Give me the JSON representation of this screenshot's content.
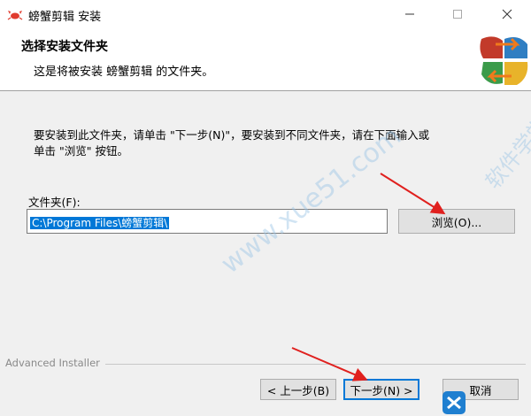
{
  "window": {
    "title": "螃蟹剪辑 安装",
    "minimize_icon": "minimize-icon",
    "maximize_icon": "maximize-icon",
    "close_icon": "close-icon"
  },
  "header": {
    "title": "选择安装文件夹",
    "subtitle": "这是将被安装 螃蟹剪辑 的文件夹。",
    "logo_icon": "installer-puzzle-logo"
  },
  "body": {
    "instruction_line1": "要安装到此文件夹，请单击 \"下一步(N)\"，要安装到不同文件夹，请在下面输入或",
    "instruction_line2": "单击 \"浏览\" 按钮。",
    "folder_label": "文件夹(F):",
    "folder_path": "C:\\Program Files\\螃蟹剪辑\\",
    "browse_label": "浏览(O)..."
  },
  "footer": {
    "brand": "Advanced Installer",
    "back_label": "< 上一步(B)",
    "next_label": "下一步(N) >",
    "cancel_label": "取消"
  },
  "watermark": {
    "text1": "www.xue51.com",
    "text2": "软件学堂"
  },
  "colors": {
    "selection": "#0078d7",
    "arrow": "#e0201e",
    "button_face": "#e1e1e1"
  }
}
